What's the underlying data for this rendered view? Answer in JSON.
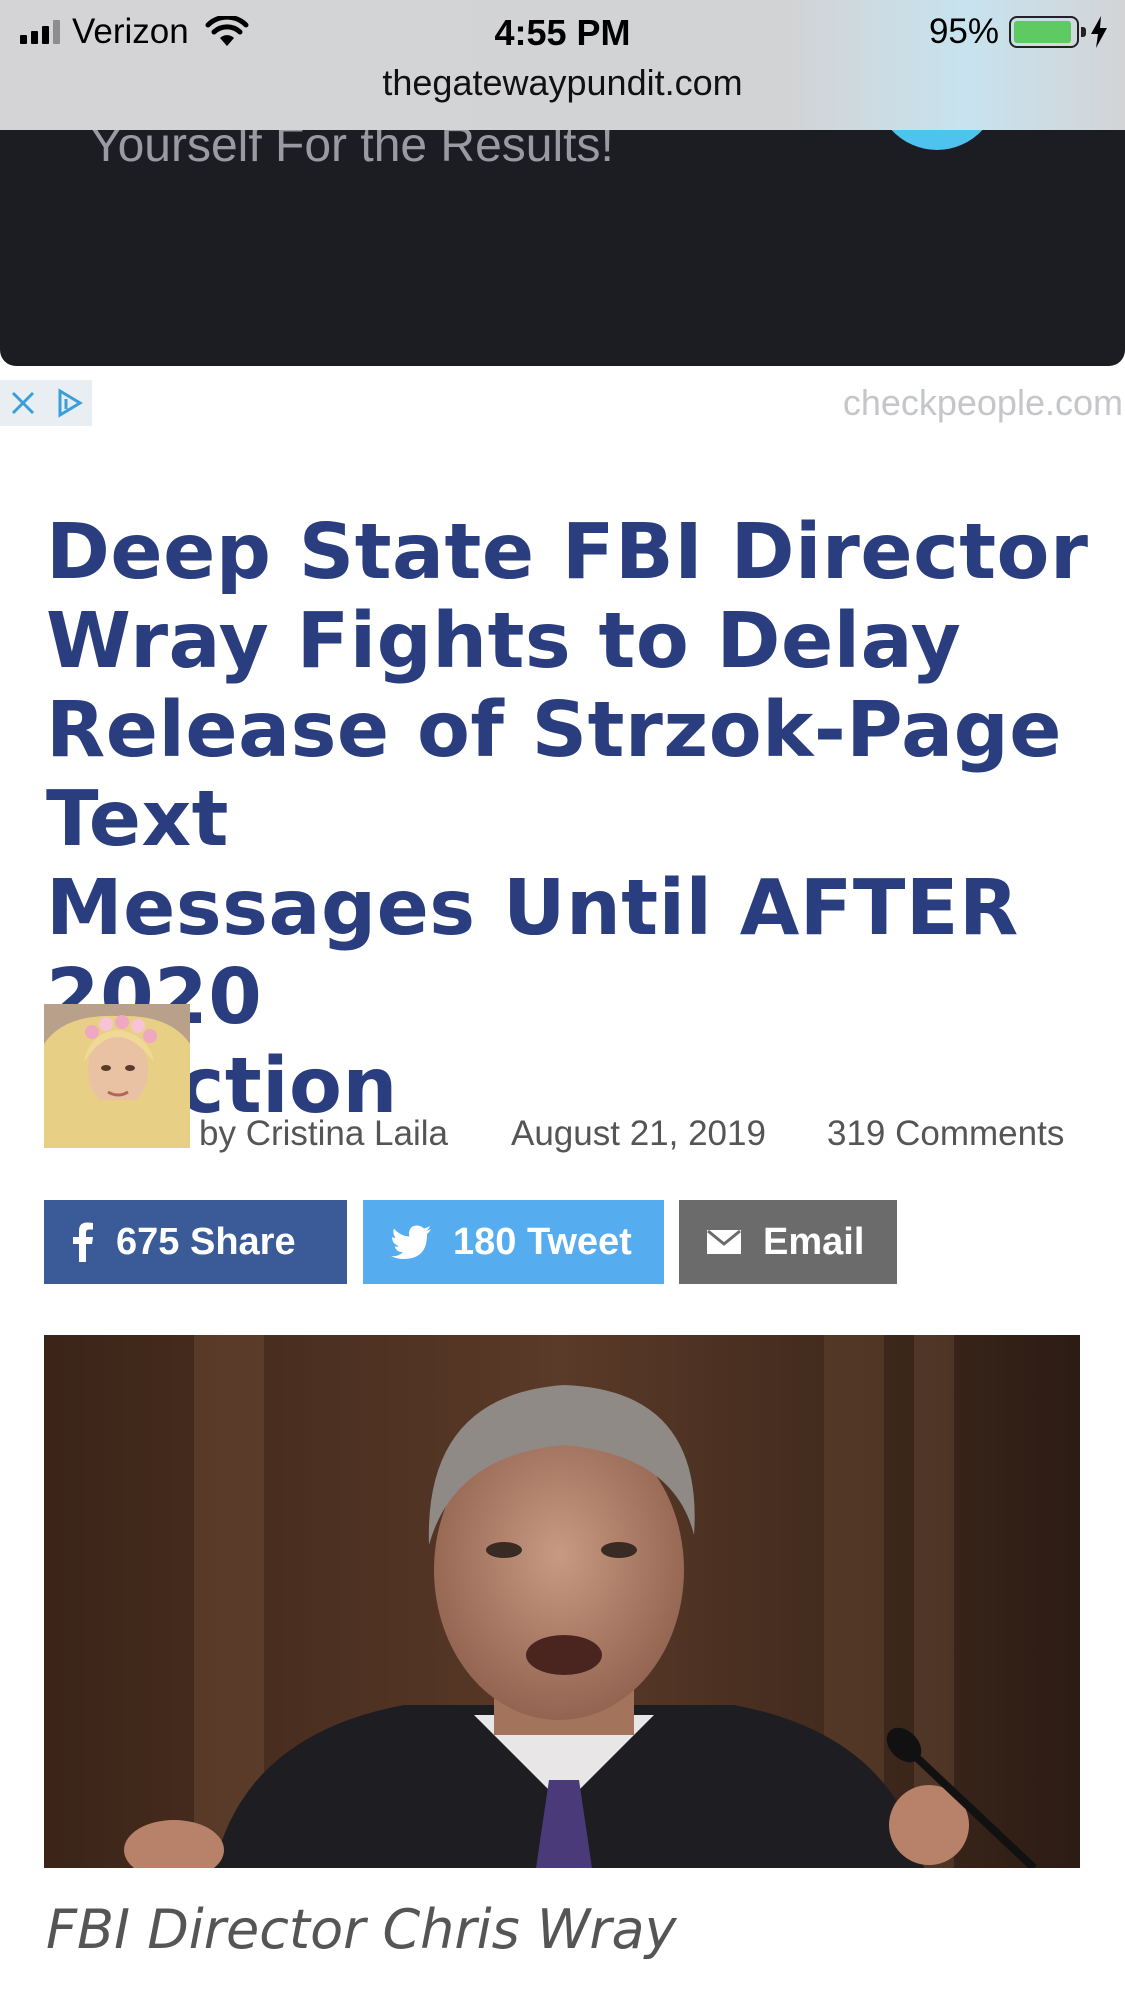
{
  "status_bar": {
    "carrier": "Verizon",
    "time": "4:55 PM",
    "battery_percent": "95%",
    "battery_level": 0.95,
    "charging": true,
    "url": "thegatewaypundit.com"
  },
  "ad": {
    "text": "Yourself For the Results!",
    "domain": "checkpeople.com",
    "close_icon": "close-icon",
    "info_icon": "adchoices-icon"
  },
  "article": {
    "headline_lines": [
      "Deep State FBI Director",
      "Wray Fights to Delay",
      "Release of Strzok-Page Text",
      "Messages Until AFTER 2020",
      "Election"
    ],
    "byline": "by Cristina Laila",
    "date": "August 21, 2019",
    "comments": "319 Comments",
    "caption": "FBI Director Chris Wray"
  },
  "share": {
    "facebook": {
      "count": "675",
      "label": "Share",
      "icon": "facebook-icon",
      "color": "#3b5a98"
    },
    "twitter": {
      "count": "180",
      "label": "Tweet",
      "icon": "twitter-icon",
      "color": "#55acee"
    },
    "email": {
      "label": "Email",
      "icon": "envelope-icon",
      "color": "#6b6b6b"
    }
  },
  "colors": {
    "headline": "#2a3e7f",
    "ad_background": "#1c1d22"
  }
}
